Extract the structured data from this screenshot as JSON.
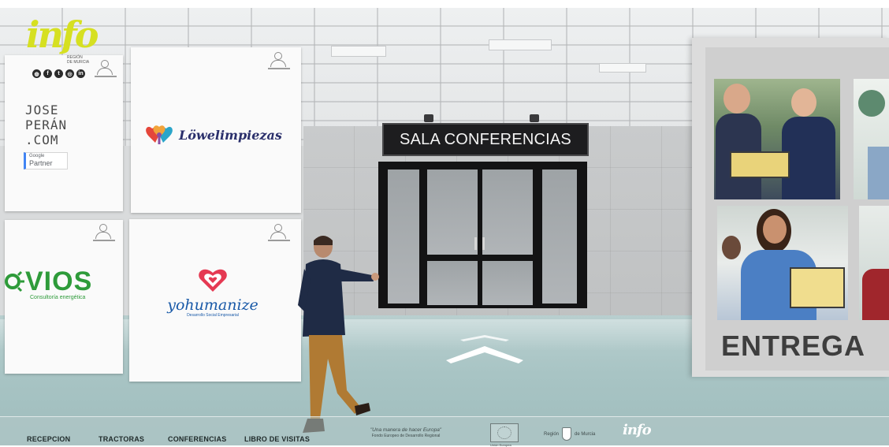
{
  "logo": {
    "wordmark": "info",
    "subtitle_line1": "REGIÓN",
    "subtitle_line2": "DE MURCIA",
    "social_icons": [
      "globe-icon",
      "facebook-icon",
      "twitter-icon",
      "instagram-icon",
      "linkedin-icon"
    ]
  },
  "hall": {
    "sign": "SALA CONFERENCIAS",
    "exhibit_title": "ENTREGA"
  },
  "booths": [
    {
      "lines": [
        "JOSE",
        "PERÁN",
        ".COM"
      ],
      "badge_small": "Google",
      "badge_big": "Partner"
    },
    {
      "name": "Löwelimpiezas"
    },
    {
      "name": "VIOS",
      "sub": "Consultoría energética"
    },
    {
      "name": "yohumanize",
      "sub": "Desarrollo Social Empresarial"
    }
  ],
  "nav": {
    "recepcion": "RECEPCION",
    "tractoras": "TRACTORAS",
    "conferencias": "CONFERENCIAS",
    "libro": "LIBRO DE VISITAS"
  },
  "footer": {
    "europa_quote": "\"Una manera de hacer Europa\"",
    "europa_fund": "Fondo Europeo de Desarrollo Regional",
    "eu_caption": "Unión Europea",
    "region_left": "Región",
    "region_right": "de Murcia",
    "info_logo": "info"
  },
  "colors": {
    "logo_yellow": "#d6e021",
    "sign_bg": "#1d1d1f",
    "vios_green": "#2e9b3a",
    "yohumanize_blue": "#1a5aa8",
    "lowe_navy": "#2a2f6b"
  }
}
